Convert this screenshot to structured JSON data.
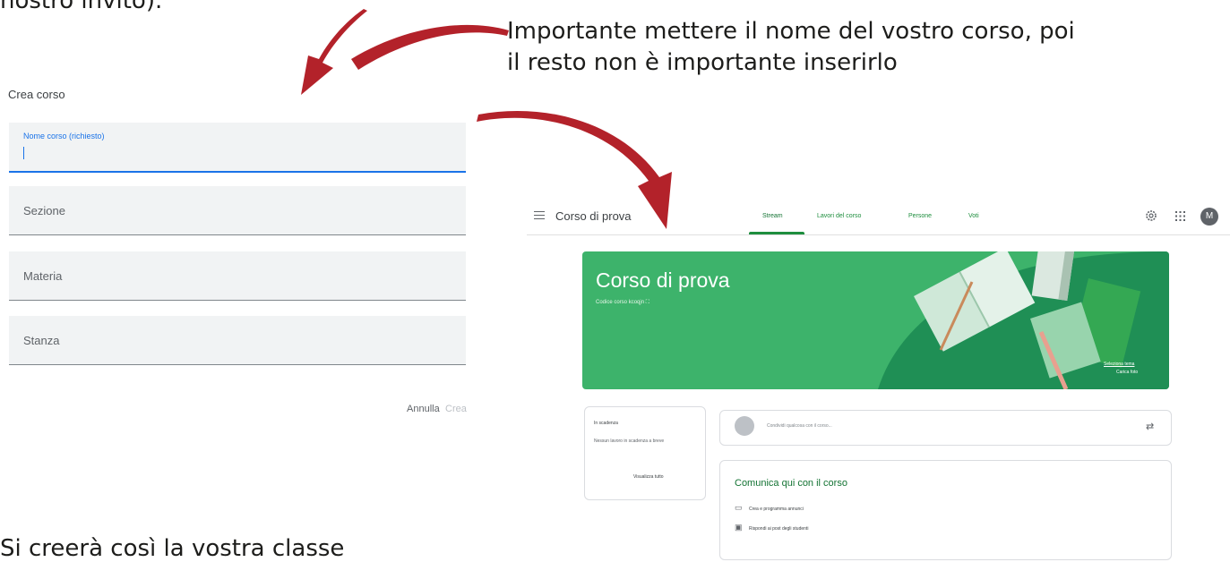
{
  "doc": {
    "top_text": "nostro invito).",
    "caption_line1": "Importante mettere il nome del vostro corso, poi",
    "caption_line2": "il resto non è importante inserirlo",
    "bottom_text": "Si creerà così la vostra classe"
  },
  "dialog": {
    "title": "Crea corso",
    "fields": [
      {
        "label": "Nome corso (richiesto)",
        "value": ""
      },
      {
        "label": "Sezione"
      },
      {
        "label": "Materia"
      },
      {
        "label": "Stanza"
      }
    ],
    "cancel_label": "Annulla",
    "create_label": "Crea"
  },
  "classroom": {
    "course_title": "Corso di prova",
    "tabs": [
      "Stream",
      "Lavori del corso",
      "Persone",
      "Voti"
    ],
    "active_tab": "Stream",
    "avatar_letter": "M",
    "banner": {
      "title": "Corso di prova",
      "code_label": "Codice corso",
      "code_value": "kcoqjn",
      "select_theme": "Seleziona tema",
      "upload_photo": "Carica foto"
    },
    "upcoming": {
      "title": "In scadenza",
      "text": "Nessun lavoro in scadenza a breve",
      "link": "Visualizza tutto"
    },
    "share_placeholder": "Condividi qualcosa con il corso...",
    "communicate": {
      "title": "Comunica qui con il corso",
      "items": [
        "Crea e programma annunci",
        "Rispondi ai post degli studenti"
      ]
    }
  },
  "colors": {
    "arrow": "#b3222a",
    "banner": "#3db36b",
    "accent": "#1e8e3e",
    "field_focus": "#1a73e8"
  }
}
